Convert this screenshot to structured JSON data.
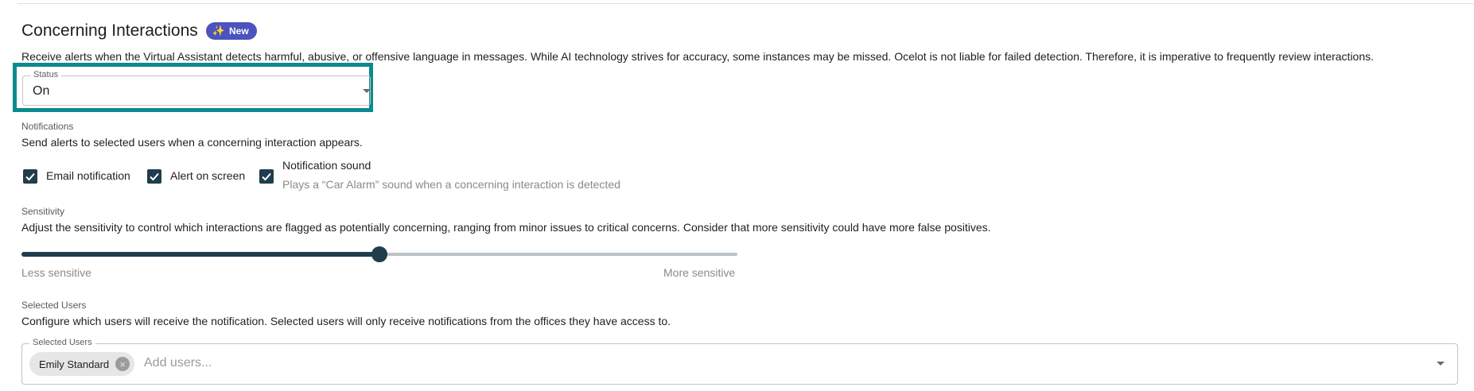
{
  "section": {
    "title": "Concerning Interactions",
    "badge": "New",
    "description": "Receive alerts when the Virtual Assistant detects harmful, abusive, or offensive language in messages. While AI technology strives for accuracy, some instances may be missed. Ocelot is not liable for failed detection. Therefore, it is imperative to frequently review interactions."
  },
  "status": {
    "label": "Status",
    "value": "On"
  },
  "notifications": {
    "heading": "Notifications",
    "description": "Send alerts to selected users when a concerning interaction appears.",
    "options": [
      {
        "label": "Email notification",
        "checked": true
      },
      {
        "label": "Alert on screen",
        "checked": true
      },
      {
        "label": "Notification sound",
        "sublabel": "Plays a “Car Alarm” sound when a concerning interaction is detected",
        "checked": true
      }
    ]
  },
  "sensitivity": {
    "heading": "Sensitivity",
    "description": "Adjust the sensitivity to control which interactions are flagged as potentially concerning, ranging from minor issues to critical concerns. Consider that more sensitivity could have more false positives.",
    "min_label": "Less sensitive",
    "max_label": "More sensitive",
    "level": 0.5
  },
  "selected_users": {
    "heading": "Selected Users",
    "description": "Configure which users will receive the notification. Selected users will only receive notifications from the offices they have access to.",
    "field_label": "Selected Users",
    "chips": [
      "Emily Standard"
    ],
    "placeholder": "Add users..."
  },
  "colors": {
    "accent": "#1f3d4d",
    "badge": "#4b53bc",
    "highlight": "#0b8a8f"
  }
}
